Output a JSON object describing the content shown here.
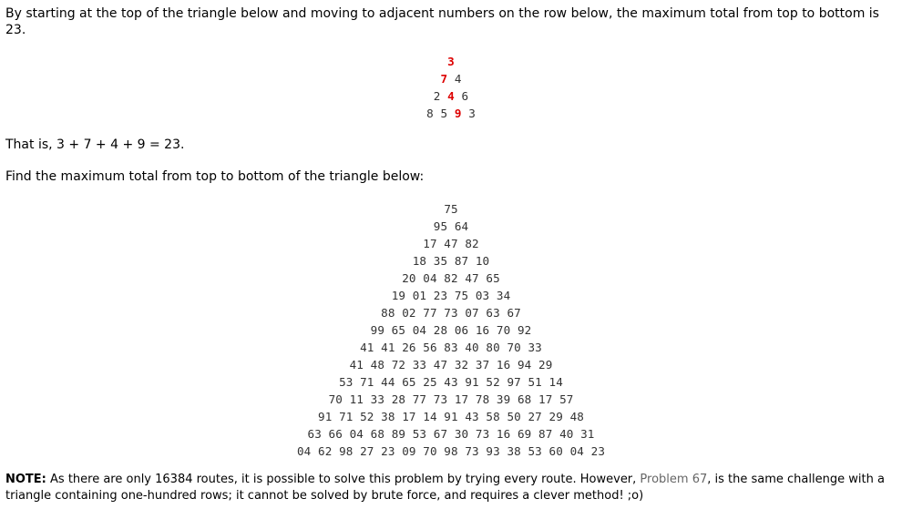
{
  "intro": "By starting at the top of the triangle below and moving to adjacent numbers on the row below, the maximum total from top to bottom is 23.",
  "example_triangle": [
    [
      {
        "v": "3",
        "hl": true
      }
    ],
    [
      {
        "v": "7",
        "hl": true
      },
      {
        "v": "4",
        "hl": false
      }
    ],
    [
      {
        "v": "2",
        "hl": false
      },
      {
        "v": "4",
        "hl": true
      },
      {
        "v": "6",
        "hl": false
      }
    ],
    [
      {
        "v": "8",
        "hl": false
      },
      {
        "v": "5",
        "hl": false
      },
      {
        "v": "9",
        "hl": true
      },
      {
        "v": "3",
        "hl": false
      }
    ]
  ],
  "highlight_color": "#dd0000",
  "that_is": "That is, 3 + 7 + 4 + 9 = 23.",
  "find": "Find the maximum total from top to bottom of the triangle below:",
  "triangle_rows": [
    "75",
    "95 64",
    "17 47 82",
    "18 35 87 10",
    "20 04 82 47 65",
    "19 01 23 75 03 34",
    "88 02 77 73 07 63 67",
    "99 65 04 28 06 16 70 92",
    "41 41 26 56 83 40 80 70 33",
    "41 48 72 33 47 32 37 16 94 29",
    "53 71 44 65 25 43 91 52 97 51 14",
    "70 11 33 28 77 73 17 78 39 68 17 57",
    "91 71 52 38 17 14 91 43 58 50 27 29 48",
    "63 66 04 68 89 53 67 30 73 16 69 87 40 31",
    "04 62 98 27 23 09 70 98 73 93 38 53 60 04 23"
  ],
  "note": {
    "label": "NOTE:",
    "text_before": " As there are only 16384 routes, it is possible to solve this problem by trying every route. However, ",
    "link": "Problem 67",
    "text_after": ", is the same challenge with a triangle containing one-hundred rows; it cannot be solved by brute force, and requires a clever method! ;o)"
  }
}
